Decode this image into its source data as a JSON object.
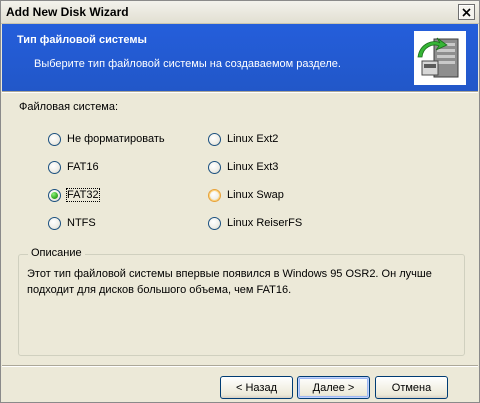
{
  "window": {
    "title": "Add New Disk Wizard",
    "close_icon": "close-icon"
  },
  "banner": {
    "title": "Тип файловой системы",
    "subtitle": "Выберите тип файловой системы на создаваемом разделе.",
    "icon": "disk-wizard-icon",
    "background_color": "#245edb"
  },
  "filesystem": {
    "label": "Файловая система:",
    "selected": "FAT32",
    "options": [
      {
        "label": "Не форматировать",
        "checked": false
      },
      {
        "label": "FAT16",
        "checked": false
      },
      {
        "label": "FAT32",
        "checked": true
      },
      {
        "label": "NTFS",
        "checked": false
      },
      {
        "label": "Linux Ext2",
        "checked": false
      },
      {
        "label": "Linux Ext3",
        "checked": false
      },
      {
        "label": "Linux Swap",
        "checked": false
      },
      {
        "label": "Linux ReiserFS",
        "checked": false
      }
    ]
  },
  "description": {
    "legend": "Описание",
    "text": "Этот тип файловой системы впервые появился в Windows 95 OSR2. Он лучше подходит для дисков большого объема, чем FAT16."
  },
  "buttons": {
    "back": "< Назад",
    "next": "Далее >",
    "cancel": "Отмена"
  },
  "colors": {
    "window_bg": "#ece9d8",
    "radio_checked": "#3db32a",
    "radio_hover_border": "#e8a23a"
  }
}
